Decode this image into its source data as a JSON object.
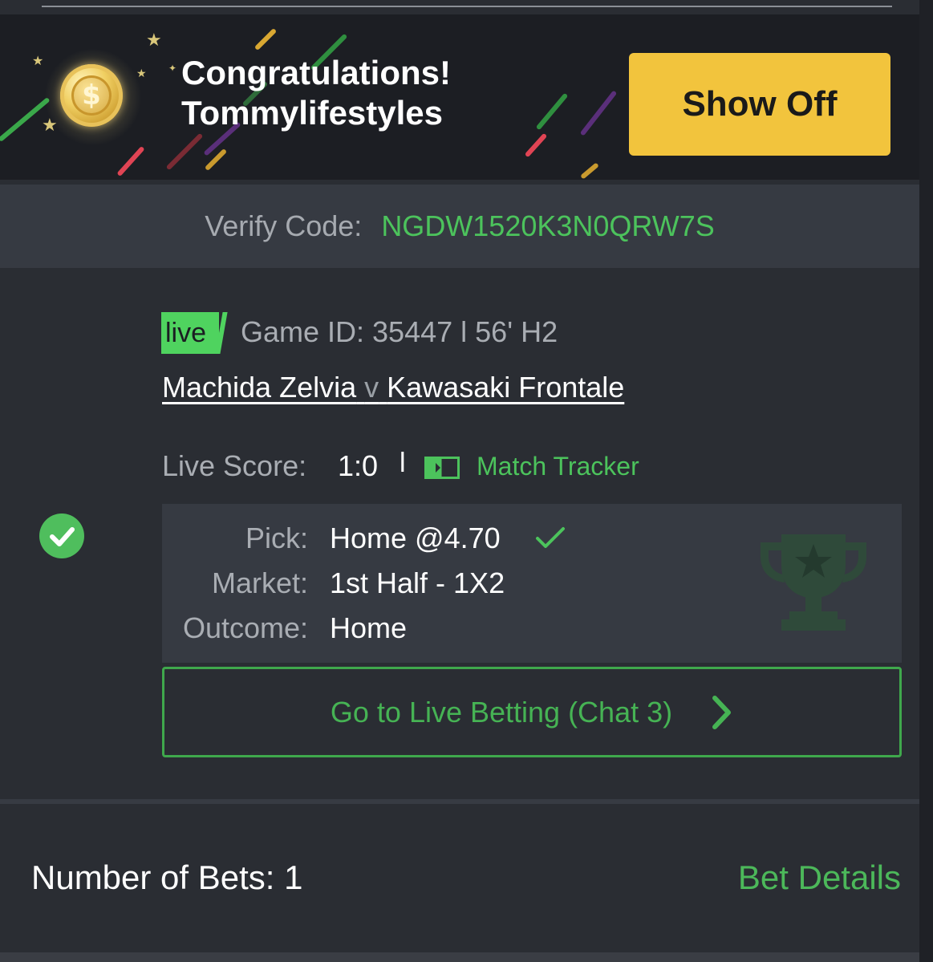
{
  "banner": {
    "title_line1": "Congratulations!",
    "title_line2": "Tommylifestyles",
    "show_off_label": "Show Off",
    "coin_icon": "coin-dollar-icon",
    "coin_symbol": "$"
  },
  "verify": {
    "label": "Verify Code:",
    "code": "NGDW1520K3N0QRW7S"
  },
  "game": {
    "live_tag": "live",
    "info": "Game ID: 35447 l 56' H2",
    "home_team": "Machida Zelvia",
    "versus": "v",
    "away_team": "Kawasaki Frontale",
    "score_label": "Live Score:",
    "score": "1:0",
    "score_separator": "l",
    "tracker_label": "Match Tracker"
  },
  "selection": {
    "pick_label": "Pick:",
    "pick_value": "Home @4.70",
    "market_label": "Market:",
    "market_value": "1st Half - 1X2",
    "outcome_label": "Outcome:",
    "outcome_value": "Home"
  },
  "actions": {
    "go_live_label": "Go to Live Betting (Chat 3)"
  },
  "footer": {
    "num_bets": "Number of Bets: 1",
    "bet_details": "Bet Details"
  },
  "colors": {
    "accent_green": "#4cc35c",
    "button_yellow": "#f2c43d",
    "background": "#2a2d33"
  }
}
